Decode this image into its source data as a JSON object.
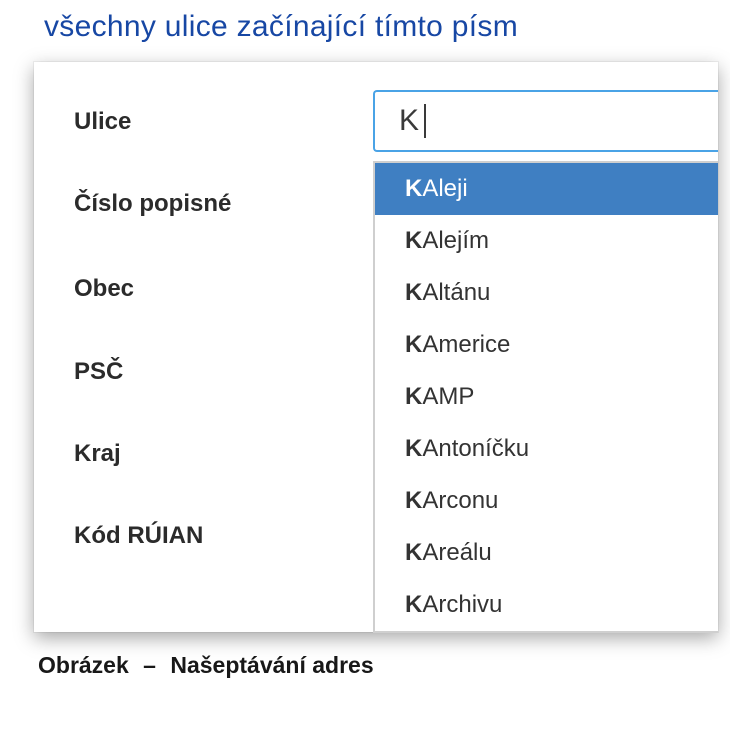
{
  "intro_text": "všechny ulice začínající tímto písm",
  "form": {
    "labels": {
      "ulice": "Ulice",
      "cislo_popisne": "Číslo popisné",
      "obec": "Obec",
      "psc": "PSČ",
      "kraj": "Kraj",
      "kod_ruian": "Kód RÚIAN"
    },
    "input_value": "K"
  },
  "suggestions": [
    {
      "match": "K",
      "rest": " Aleji",
      "highlighted": true
    },
    {
      "match": "K",
      "rest": " Alejím",
      "highlighted": false
    },
    {
      "match": "K",
      "rest": " Altánu",
      "highlighted": false
    },
    {
      "match": "K",
      "rest": " Americe",
      "highlighted": false
    },
    {
      "match": "K",
      "rest": " AMP",
      "highlighted": false
    },
    {
      "match": "K",
      "rest": " Antoníčku",
      "highlighted": false
    },
    {
      "match": "K",
      "rest": " Arconu",
      "highlighted": false
    },
    {
      "match": "K",
      "rest": " Areálu",
      "highlighted": false
    },
    {
      "match": "K",
      "rest": " Archivu",
      "highlighted": false
    }
  ],
  "caption": {
    "prefix": "Obrázek",
    "sep": "–",
    "title": "Našeptávání adres"
  }
}
